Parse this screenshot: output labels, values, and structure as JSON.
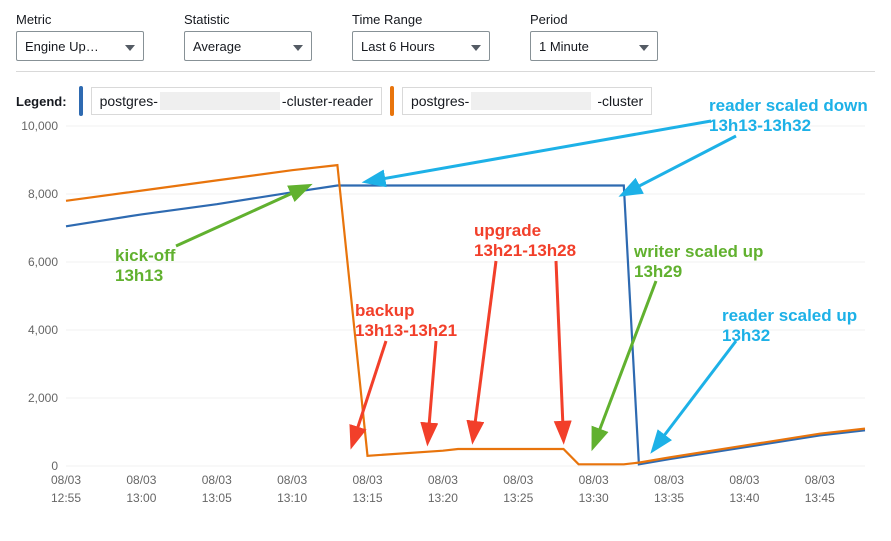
{
  "controls": {
    "metric": {
      "label": "Metric",
      "value": "Engine Up…"
    },
    "statistic": {
      "label": "Statistic",
      "value": "Average"
    },
    "timerange": {
      "label": "Time Range",
      "value": "Last 6 Hours"
    },
    "period": {
      "label": "Period",
      "value": "1 Minute"
    }
  },
  "legend": {
    "label": "Legend:",
    "items": [
      {
        "color": "#2e6ab1",
        "prefix": "postgres-",
        "suffix": "-cluster-reader"
      },
      {
        "color": "#e8740c",
        "prefix": "postgres-",
        "suffix": "-cluster"
      }
    ]
  },
  "annotations": {
    "kickoff": {
      "line1": "kick-off",
      "line2": "13h13",
      "color": "#61b12f"
    },
    "backup": {
      "line1": "backup",
      "line2": "13h13-13h21",
      "color": "#f23f2a"
    },
    "upgrade": {
      "line1": "upgrade",
      "line2": "13h21-13h28",
      "color": "#f23f2a"
    },
    "writer_up": {
      "line1": "writer scaled up",
      "line2": "13h29",
      "color": "#61b12f"
    },
    "reader_down": {
      "line1": "reader scaled down",
      "line2": "13h13-13h32",
      "color": "#1db1e7"
    },
    "reader_up": {
      "line1": "reader scaled up",
      "line2": "13h32",
      "color": "#1db1e7"
    }
  },
  "chart_data": {
    "type": "line",
    "ylabel": "",
    "xlabel": "",
    "ylim": [
      0,
      10000
    ],
    "y_ticks": [
      0,
      2000,
      4000,
      6000,
      8000,
      10000
    ],
    "y_tick_labels": [
      "0",
      "2,000",
      "4,000",
      "6,000",
      "8,000",
      "10,000"
    ],
    "x_ticks": [
      "08/03\n12:55",
      "08/03\n13:00",
      "08/03\n13:05",
      "08/03\n13:10",
      "08/03\n13:15",
      "08/03\n13:20",
      "08/03\n13:25",
      "08/03\n13:30",
      "08/03\n13:35",
      "08/03\n13:40",
      "08/03\n13:45"
    ],
    "x": [
      "12:55",
      "13:00",
      "13:05",
      "13:10",
      "13:13",
      "13:15",
      "13:20",
      "13:21",
      "13:25",
      "13:28",
      "13:29",
      "13:30",
      "13:32",
      "13:33",
      "13:35",
      "13:40",
      "13:45",
      "13:48"
    ],
    "series": [
      {
        "name": "postgres-…-cluster-reader",
        "color": "#2e6ab1",
        "values": [
          7050,
          7400,
          7700,
          8050,
          8250,
          8250,
          8250,
          8250,
          8250,
          8250,
          8250,
          8250,
          8250,
          50,
          200,
          550,
          900,
          1050
        ]
      },
      {
        "name": "postgres-…-cluster",
        "color": "#e8740c",
        "values": [
          7800,
          8100,
          8400,
          8700,
          8850,
          300,
          450,
          500,
          500,
          500,
          50,
          50,
          50,
          100,
          250,
          600,
          950,
          1100
        ]
      }
    ]
  }
}
